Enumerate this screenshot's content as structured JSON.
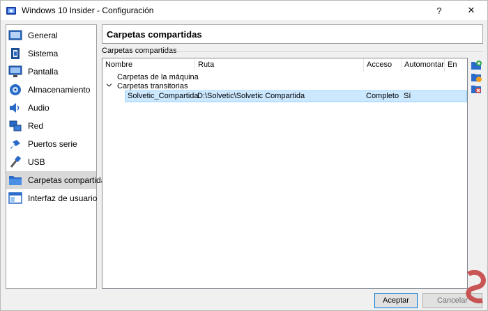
{
  "window": {
    "title": "Windows 10 Insider - Configuración",
    "help_label": "?",
    "close_label": "✕"
  },
  "sidebar": {
    "items": [
      {
        "label": "General",
        "icon": "general-icon"
      },
      {
        "label": "Sistema",
        "icon": "system-chip-icon"
      },
      {
        "label": "Pantalla",
        "icon": "display-monitor-icon"
      },
      {
        "label": "Almacenamiento",
        "icon": "storage-disk-icon"
      },
      {
        "label": "Audio",
        "icon": "speaker-icon"
      },
      {
        "label": "Red",
        "icon": "network-icon"
      },
      {
        "label": "Puertos serie",
        "icon": "serial-port-icon"
      },
      {
        "label": "USB",
        "icon": "usb-icon"
      },
      {
        "label": "Carpetas compartidas",
        "icon": "folder-icon",
        "selected": true
      },
      {
        "label": "Interfaz de usuario",
        "icon": "user-interface-icon"
      }
    ]
  },
  "main": {
    "header": "Carpetas compartidas",
    "group_label": "Carpetas compartidas",
    "table": {
      "columns": [
        "Nombre",
        "Ruta",
        "Acceso",
        "Automontar",
        "En"
      ],
      "group_machine": "Carpetas de la máquina",
      "group_transient": "Carpetas transitorias",
      "rows": [
        {
          "name": "Solvetic_Compartida",
          "path": "D:\\Solvetic\\Solvetic Compartida",
          "access": "Completo",
          "automount": "Sí",
          "at": ""
        }
      ]
    }
  },
  "buttons": {
    "ok": "Aceptar",
    "cancel": "Cancelar"
  },
  "colors": {
    "selection_bg": "#cce8ff",
    "selection_border": "#99d1ff",
    "sidebar_selected": "#d9d9d9",
    "accent": "#0078d7"
  }
}
